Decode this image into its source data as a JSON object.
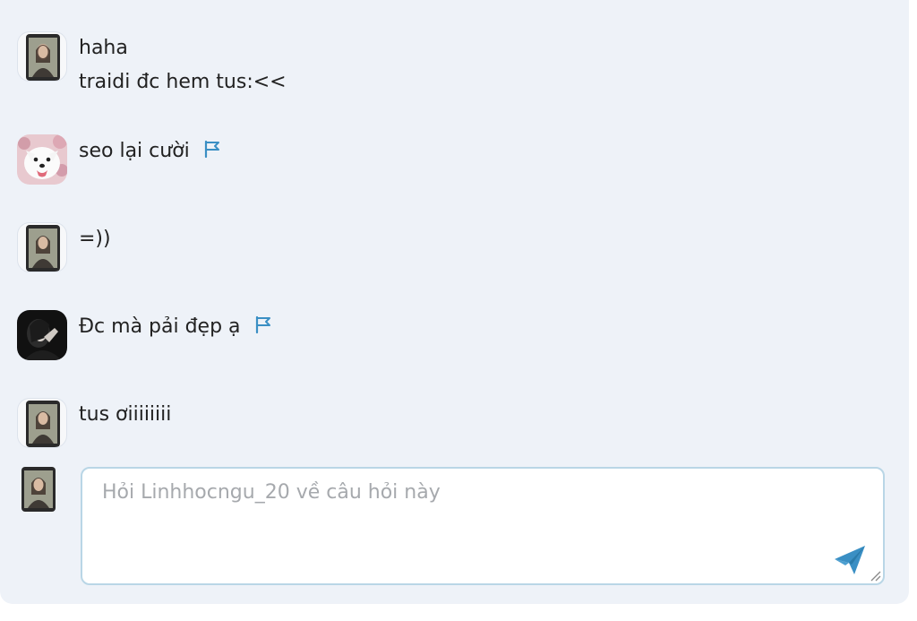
{
  "messages": [
    {
      "lines": [
        "haha",
        "traidi đc hem tus:<<"
      ],
      "avatar": "girl-selfie-avatar",
      "flag": false
    },
    {
      "lines": [
        "seo lại cười"
      ],
      "avatar": "samoyed-dog-avatar",
      "flag": true
    },
    {
      "lines": [
        "=))"
      ],
      "avatar": "girl-selfie-avatar",
      "flag": false
    },
    {
      "lines": [
        "Đc mà pải đẹp ạ"
      ],
      "avatar": "dark-portrait-avatar",
      "flag": true
    },
    {
      "lines": [
        "tus ơiiiiiiii"
      ],
      "avatar": "girl-selfie-avatar",
      "flag": false
    }
  ],
  "composer": {
    "placeholder": "Hỏi Linhhocngu_20 về câu hỏi này",
    "value": "",
    "send_icon": "send-icon"
  },
  "colors": {
    "panel_bg": "#eef2f8",
    "text": "#222222",
    "accent": "#3a8fc4",
    "input_border": "#b9d6e6"
  }
}
